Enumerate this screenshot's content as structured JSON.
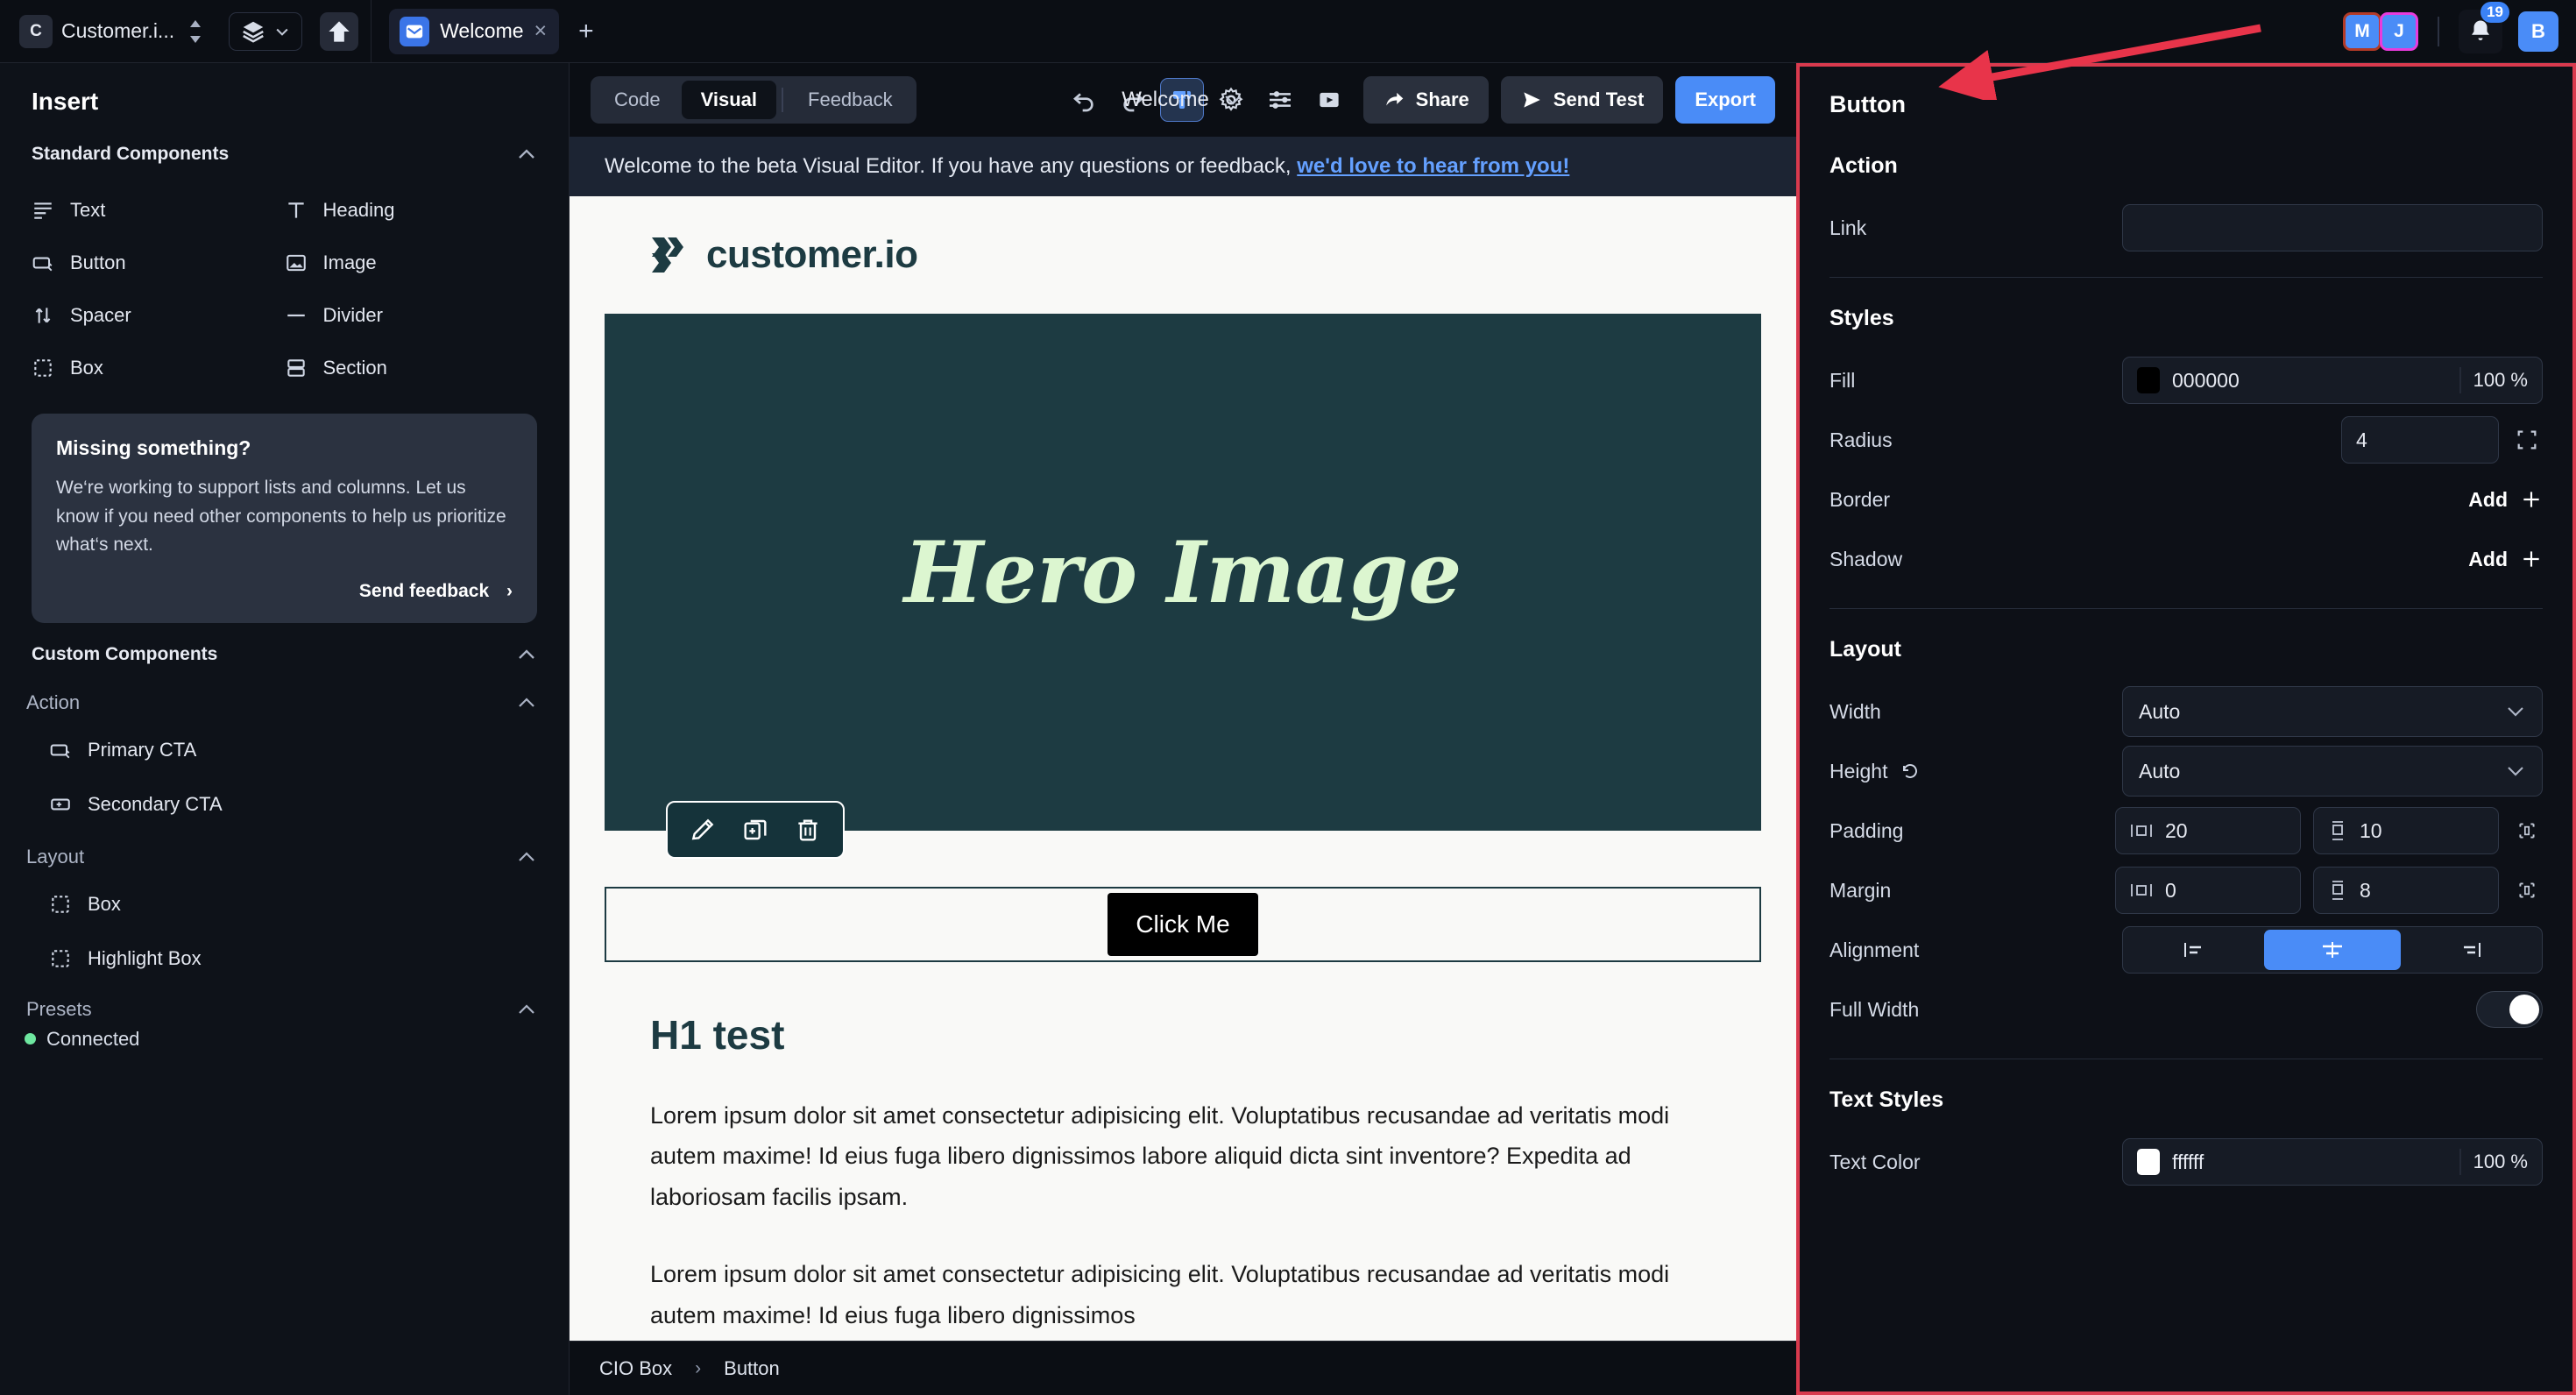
{
  "topbar": {
    "workspace_badge": "C",
    "workspace_name": "Customer.i...",
    "tab": {
      "label": "Welcome",
      "close": "×"
    },
    "add_tab": "+",
    "avatars": [
      {
        "initial": "M",
        "border_color": "#b33a26"
      },
      {
        "initial": "J",
        "border_color": "#e83bdc"
      }
    ],
    "notifications_count": "19",
    "user_initial": "B"
  },
  "left_panel": {
    "title": "Insert",
    "standard_components": {
      "heading": "Standard Components",
      "items": [
        {
          "label": "Text",
          "icon": "text-lines-icon"
        },
        {
          "label": "Heading",
          "icon": "heading-t-icon"
        },
        {
          "label": "Button",
          "icon": "button-icon"
        },
        {
          "label": "Image",
          "icon": "image-icon"
        },
        {
          "label": "Spacer",
          "icon": "spacer-arrows-icon"
        },
        {
          "label": "Divider",
          "icon": "divider-line-icon"
        },
        {
          "label": "Box",
          "icon": "dashed-box-icon"
        },
        {
          "label": "Section",
          "icon": "section-icon"
        }
      ]
    },
    "feedback_card": {
      "title": "Missing something?",
      "body": "We‘re working to support lists and columns. Let us know if you need other components to help us prioritize what‘s next.",
      "link": "Send feedback",
      "link_arrow": "›"
    },
    "custom_components": {
      "heading": "Custom Components",
      "groups": [
        {
          "name": "Action",
          "items": [
            {
              "label": "Primary CTA",
              "icon": "button-icon"
            },
            {
              "label": "Secondary CTA",
              "icon": "button-plus-icon"
            }
          ]
        },
        {
          "name": "Layout",
          "items": [
            {
              "label": "Box",
              "icon": "dashed-box-icon"
            },
            {
              "label": "Highlight Box",
              "icon": "dashed-box-icon"
            }
          ]
        }
      ],
      "presets_label": "Presets",
      "status": "Connected",
      "status_color": "#6ee7a0"
    }
  },
  "editor_toolbar": {
    "segments": [
      {
        "label": "Code",
        "active": false
      },
      {
        "label": "Visual",
        "active": true
      },
      {
        "label": "Feedback",
        "active": false
      }
    ],
    "document_name": "Welcome",
    "icons": [
      {
        "name": "undo-icon",
        "active": false
      },
      {
        "name": "redo-icon",
        "active": false
      },
      {
        "name": "paintbrush-icon",
        "active": true
      },
      {
        "name": "gear-icon",
        "active": false
      },
      {
        "name": "sliders-icon",
        "active": false
      },
      {
        "name": "play-preview-icon",
        "active": false
      }
    ],
    "share_label": "Share",
    "send_test_label": "Send Test",
    "export_label": "Export"
  },
  "banner": {
    "text": "Welcome to the beta Visual Editor. If you have any questions or feedback, ",
    "link": "we'd love to hear from you!"
  },
  "canvas": {
    "logo_text": "customer.io",
    "hero_text": "Hero Image",
    "hero_bg": "#1d3b42",
    "hero_text_color": "#dcf6d0",
    "element_toolbar": [
      {
        "name": "edit-pencil-icon"
      },
      {
        "name": "duplicate-icon"
      },
      {
        "name": "delete-trash-icon"
      }
    ],
    "button_label": "Click Me",
    "h1": "H1 test",
    "paragraph_1": "Lorem ipsum dolor sit amet consectetur adipisicing elit. Voluptatibus recusandae ad veritatis modi autem maxime! Id eius fuga libero dignissimos labore aliquid dicta sint inventore? Expedita ad laboriosam facilis ipsam.",
    "paragraph_2": "Lorem ipsum dolor sit amet consectetur adipisicing elit. Voluptatibus recusandae ad veritatis modi autem maxime! Id eius fuga libero dignissimos"
  },
  "breadcrumb": {
    "parent": "CIO Box",
    "sep": "›",
    "current": "Button"
  },
  "right_panel": {
    "title": "Button",
    "sections": {
      "action": {
        "heading": "Action",
        "link_label": "Link",
        "link_value": "",
        "link_placeholder": ""
      },
      "styles": {
        "heading": "Styles",
        "fill_label": "Fill",
        "fill_value": "000000",
        "fill_swatch": "#000000",
        "fill_opacity": "100 %",
        "radius_label": "Radius",
        "radius_value": "4",
        "border_label": "Border",
        "border_action": "Add",
        "shadow_label": "Shadow",
        "shadow_action": "Add"
      },
      "layout": {
        "heading": "Layout",
        "width_label": "Width",
        "width_value": "Auto",
        "height_label": "Height",
        "height_value": "Auto",
        "padding_label": "Padding",
        "padding_x": "20",
        "padding_y": "10",
        "margin_label": "Margin",
        "margin_x": "0",
        "margin_y": "8",
        "alignment_label": "Alignment",
        "alignment_selected": "center",
        "full_width_label": "Full Width",
        "full_width_on": true
      },
      "text_styles": {
        "heading": "Text Styles",
        "text_color_label": "Text Color",
        "text_color_value": "ffffff",
        "text_color_swatch": "#ffffff",
        "text_color_opacity": "100 %"
      }
    },
    "highlight_color": "#d93a4e"
  }
}
